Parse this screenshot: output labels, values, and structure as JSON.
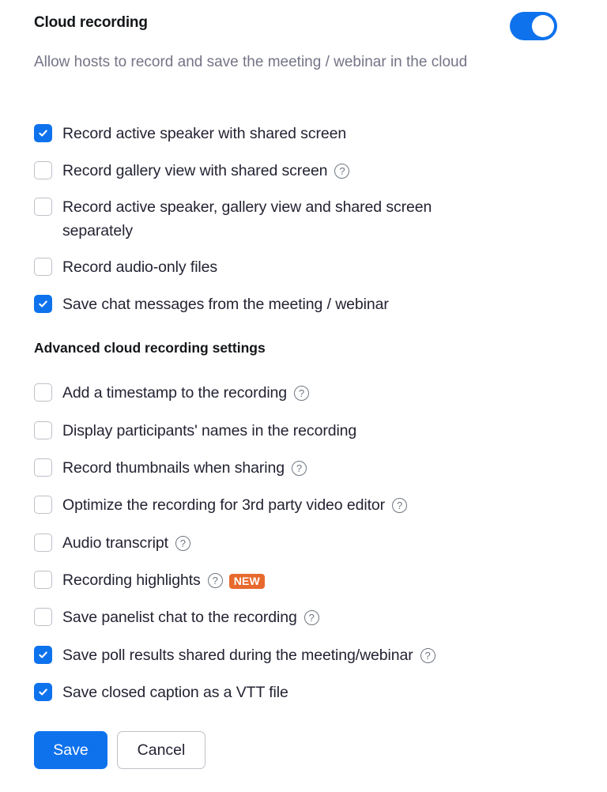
{
  "header": {
    "title": "Cloud recording",
    "toggle_on": true,
    "description": "Allow hosts to record and save the meeting / webinar in the cloud"
  },
  "basic_options": [
    {
      "label": "Record active speaker with shared screen",
      "checked": true,
      "help": false
    },
    {
      "label": "Record gallery view with shared screen",
      "checked": false,
      "help": true
    },
    {
      "label": "Record active speaker, gallery view and shared screen separately",
      "checked": false,
      "help": false
    },
    {
      "label": "Record audio-only files",
      "checked": false,
      "help": false
    },
    {
      "label": "Save chat messages from the meeting / webinar",
      "checked": true,
      "help": false
    }
  ],
  "advanced": {
    "title": "Advanced cloud recording settings",
    "options": [
      {
        "label": "Add a timestamp to the recording",
        "checked": false,
        "help": true
      },
      {
        "label": "Display participants' names in the recording",
        "checked": false,
        "help": false
      },
      {
        "label": "Record thumbnails when sharing",
        "checked": false,
        "help": true
      },
      {
        "label": "Optimize the recording for 3rd party video editor",
        "checked": false,
        "help": true
      },
      {
        "label": "Audio transcript",
        "checked": false,
        "help": true
      },
      {
        "label": "Recording highlights",
        "checked": false,
        "help": true,
        "badge": "NEW"
      },
      {
        "label": "Save panelist chat to the recording",
        "checked": false,
        "help": true
      },
      {
        "label": "Save poll results shared during the meeting/webinar",
        "checked": true,
        "help": true
      },
      {
        "label": "Save closed caption as a VTT file",
        "checked": true,
        "help": false
      }
    ]
  },
  "help_icon_glyph": "?",
  "buttons": {
    "save": "Save",
    "cancel": "Cancel"
  },
  "colors": {
    "accent": "#0e72ed",
    "badge": "#e8692d"
  }
}
